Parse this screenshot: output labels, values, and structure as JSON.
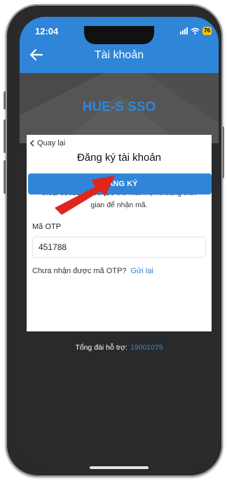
{
  "status_bar": {
    "time": "12:04",
    "battery": "76"
  },
  "header": {
    "title": "Tài khoản"
  },
  "banner": {
    "brand": "HUE-S SSO"
  },
  "card": {
    "back_label": "Quay lại",
    "heading": "Đăng ký tài khoản",
    "instructions": "Vui lòng nhập mã xác thực được gửi tới số điện thoại 0902834660. Có thể mất một khoảng thời gian để nhận mã.",
    "otp_label": "Mã OTP",
    "otp_value": "451788",
    "resend_prompt": "Chưa nhận được mã OTP?",
    "resend_link": "Gửi lại",
    "register_button": "ĐĂNG KÝ"
  },
  "footer": {
    "hotline_label": "Tổng đài hỗ trợ:",
    "hotline_number": "19001075"
  },
  "colors": {
    "accent": "#2f86d8",
    "annotation_arrow": "#e0261c"
  }
}
